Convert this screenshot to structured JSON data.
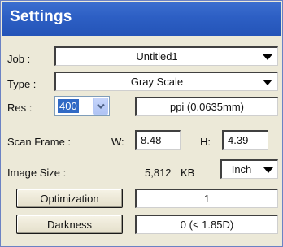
{
  "title": "Settings",
  "job": {
    "label": "Job :",
    "value": "Untitled1"
  },
  "type": {
    "label": "Type :",
    "value": "Gray Scale"
  },
  "res": {
    "label": "Res :",
    "value": "400",
    "unit": "ppi (0.0635mm)"
  },
  "scan_frame": {
    "label": "Scan Frame :",
    "w_label": "W:",
    "w_value": "8.48",
    "h_label": "H:",
    "h_value": "4.39"
  },
  "image_size": {
    "label": "Image Size :",
    "value": "5,812",
    "unit": "KB",
    "unit_select": "Inch"
  },
  "optimization": {
    "button": "Optimization",
    "value": "1"
  },
  "darkness": {
    "button": "Darkness",
    "value": "0 (< 1.85D)"
  },
  "colors": {
    "title_bar": "#2d5fc4",
    "panel_bg": "#ece9d8",
    "selection": "#316ac5"
  },
  "icons": [
    "dropdown-arrow-icon",
    "chevron-down-icon"
  ]
}
